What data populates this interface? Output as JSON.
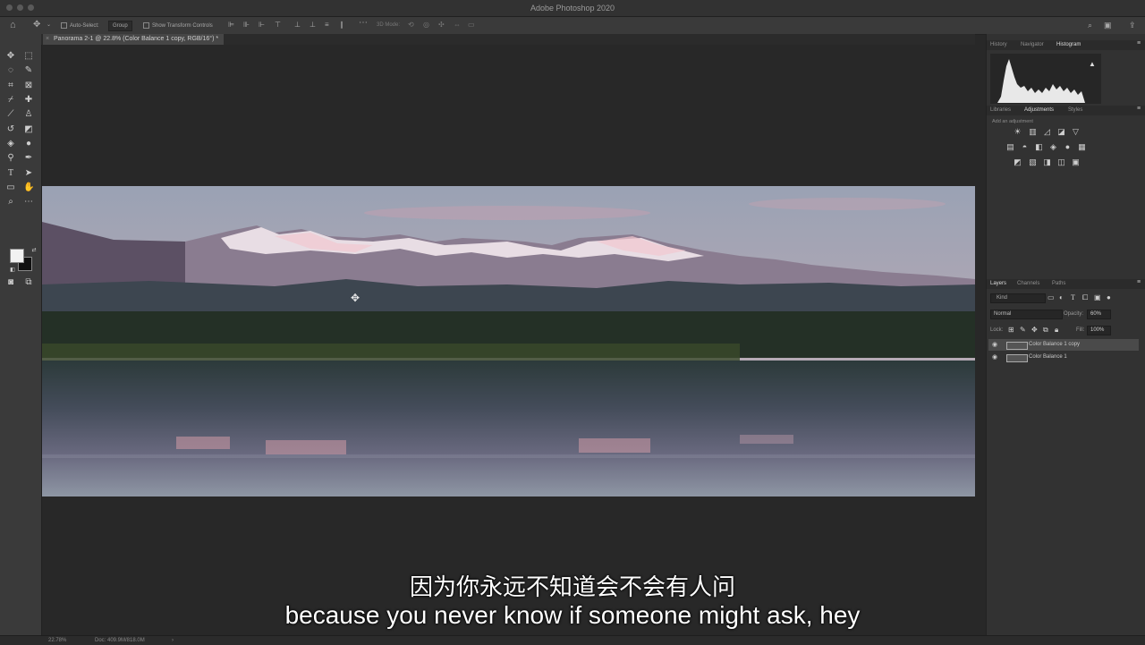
{
  "app": {
    "title": "Adobe Photoshop 2020"
  },
  "options_bar": {
    "auto_select_label": "Auto-Select:",
    "auto_select_target": "Group",
    "show_transform_controls_label": "Show Transform Controls",
    "mode_3d_label": "3D Mode:"
  },
  "document": {
    "tab_title": "Panorama 2-1 @ 22.8% (Color Balance 1 copy, RGB/16°) *"
  },
  "right_panel": {
    "top_tabs": [
      "History",
      "Navigator",
      "Histogram"
    ],
    "top_active": "Histogram",
    "mid_tabs": [
      "Libraries",
      "Adjustments",
      "Styles"
    ],
    "mid_active": "Adjustments",
    "adjustments_caption": "Add an adjustment",
    "layer_tabs": [
      "Layers",
      "Channels",
      "Paths"
    ],
    "layers_active": "Layers",
    "filter_kind": "Kind",
    "blend_mode": "Normal",
    "opacity_label": "Opacity:",
    "opacity_value": "60%",
    "lock_label": "Lock:",
    "fill_label": "Fill:",
    "fill_value": "100%",
    "layers": [
      {
        "name": "Color Balance 1 copy",
        "selected": true,
        "visible": true
      },
      {
        "name": "Color Balance 1",
        "selected": false,
        "visible": true
      }
    ]
  },
  "status_bar": {
    "zoom": "22.78%",
    "doc_info": "Doc: 409.9M/818.0M"
  },
  "subtitles": {
    "chinese": "因为你永远不知道会不会有人问",
    "english": "because you never know if someone might ask, hey"
  },
  "colors": {
    "app_bg": "#282828",
    "panel_bg": "#323232",
    "toolbar_bg": "#3a3a3a",
    "selected_layer": "#4a4a4a"
  }
}
